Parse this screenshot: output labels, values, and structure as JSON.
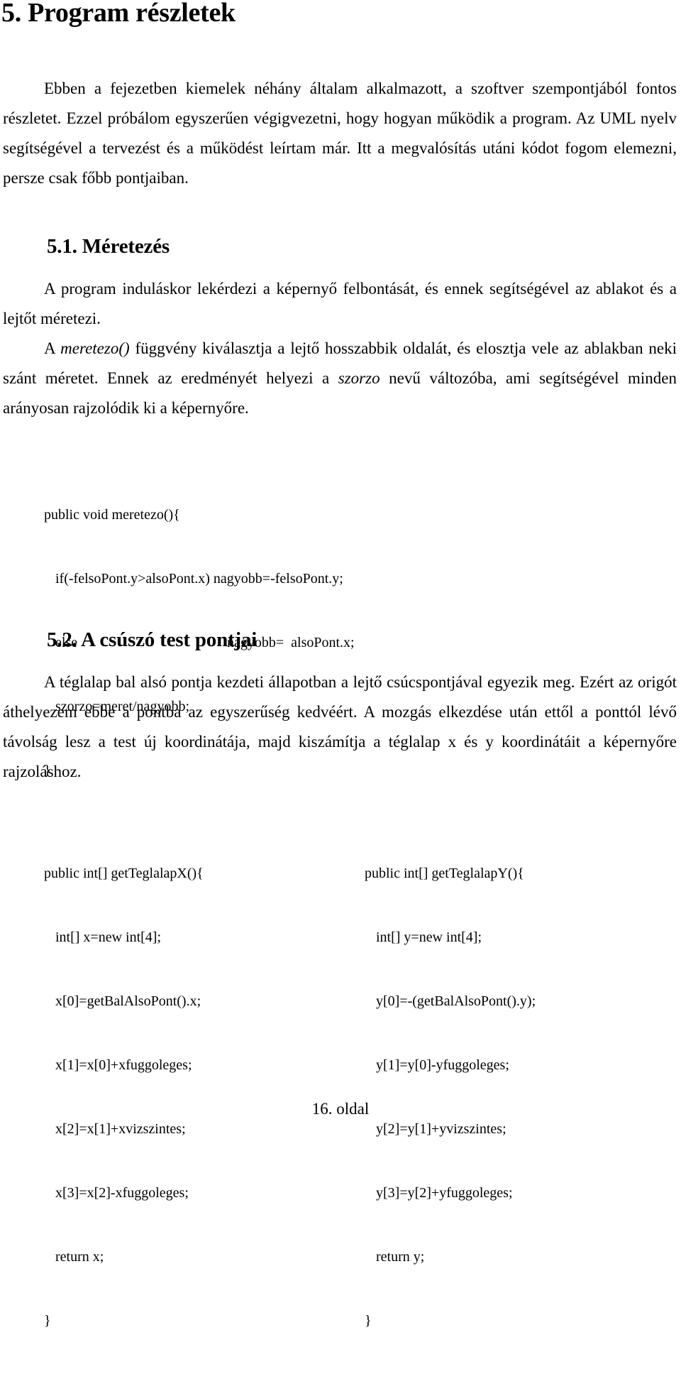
{
  "document": {
    "title": "5. Program részletek",
    "language": "hu",
    "page_footer": "16. oldal"
  },
  "intro": {
    "paragraph": "Ebben a fejezetben kiemelek néhány általam alkalmazott, a szoftver szempontjából fontos részletet. Ezzel próbálom egyszerűen végigvezetni, hogy hogyan működik a program. Az UML nyelv segítségével a tervezést és a működést leírtam már. Itt a megvalósítás utáni kódot fogom elemezni, persze csak főbb pontjaiban."
  },
  "section_51": {
    "heading": "5.1. Méretezés",
    "paragraph1": "A program induláskor lekérdezi a képernyő felbontását, és ennek segítségével az ablakot és a lejtőt méretezi.",
    "paragraph2": {
      "part1": "A ",
      "em1": "meretezo()",
      "part2": " függvény kiválasztja a lejtő hosszabbik oldalát, és elosztja vele az ablakban neki szánt méretet. Ennek az eredményét helyezi a ",
      "em2": "szorzo",
      "part3": " nevű változóba, ami segítségével minden arányosan rajzolódik ki a képernyőre."
    },
    "code": {
      "line1": "public void meretezo(){",
      "line2": "if(-felsoPont.y>alsoPont.x) nagyobb=-felsoPont.y;",
      "line3_keyword": "else",
      "line3_body": "nagyobb=  alsoPont.x;",
      "line4": "szorzo=meret/nagyobb;",
      "line5": "}"
    }
  },
  "section_52": {
    "heading": "5.2. A csúszó test pontjai",
    "paragraph": "A téglalap bal alsó pontja kezdeti állapotban a lejtő csúcspontjával egyezik meg. Ezért az origót áthelyezem ebbe a pontba az egyszerűség kedvéért. A mozgás elkezdése után ettől a ponttól lévő távolság lesz a test új koordinátája, majd kiszámítja a téglalap x és y koordinátáit a képernyőre rajzoláshoz.",
    "code_left": {
      "line1": "public int[] getTeglalapX(){",
      "line2": "int[] x=new int[4];",
      "line3": "x[0]=getBalAlsoPont().x;",
      "line4": "x[1]=x[0]+xfuggoleges;",
      "line5": "x[2]=x[1]+xvizszintes;",
      "line6": "x[3]=x[2]-xfuggoleges;",
      "line7": "return x;",
      "line8": "}"
    },
    "code_right": {
      "line1": "public int[] getTeglalapY(){",
      "line2": "int[] y=new int[4];",
      "line3": "y[0]=-(getBalAlsoPont().y);",
      "line4": "y[1]=y[0]-yfuggoleges;",
      "line5": "y[2]=y[1]+yvizszintes;",
      "line6": "y[3]=y[2]+yfuggoleges;",
      "line7": "return y;",
      "line8": "}"
    }
  }
}
